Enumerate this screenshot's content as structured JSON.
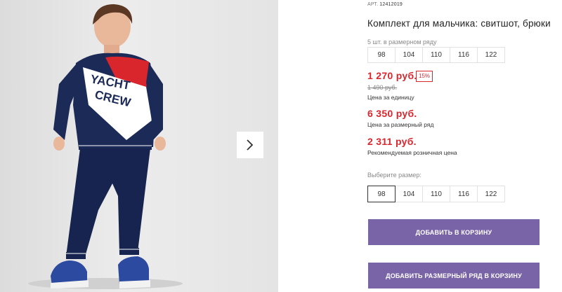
{
  "product": {
    "art_label": "АРТ.",
    "art_number": "12412019",
    "title": "Комплект для мальчика: свитшот, брюки",
    "size_row_note": "5 шт. в размерном ряду",
    "sizes": [
      "98",
      "104",
      "110",
      "116",
      "122"
    ],
    "price": "1 270 руб.",
    "discount": "15%",
    "old_price": "1 490 руб.",
    "price_caption": "Цена за единицу",
    "row_price": "6 350 руб.",
    "row_price_caption": "Цена за размерный ряд",
    "retail_price": "2 311 руб.",
    "retail_caption": "Рекомендуемая розничная цена",
    "choose_size_label": "Выберите размер:",
    "selected_size": "98",
    "add_to_cart": "ДОБАВИТЬ В КОРЗИНУ",
    "add_row_to_cart": "ДОБАВИТЬ РАЗМЕРНЫЙ РЯД В КОРЗИНУ"
  },
  "gallery": {
    "next_icon": "chevron-right-icon",
    "sweatshirt_text_1": "YACHT",
    "sweatshirt_text_2": "CREW"
  },
  "colors": {
    "price_red": "#d9272e",
    "button_purple": "#7a64a8",
    "navy": "#1c2a57"
  }
}
